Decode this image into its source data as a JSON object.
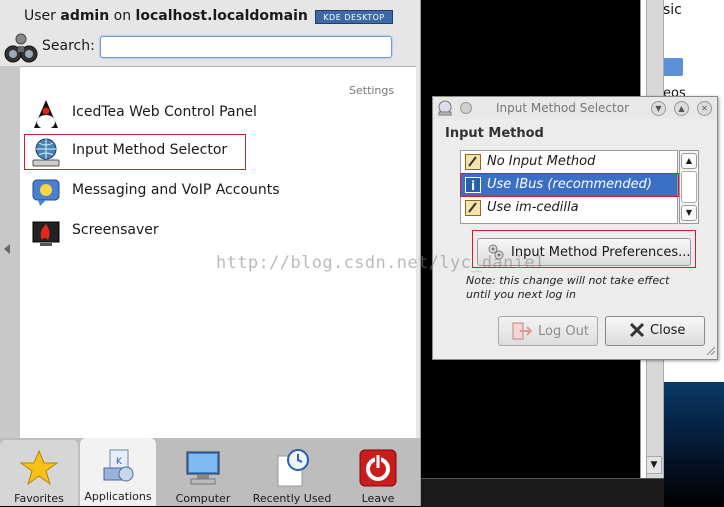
{
  "launcher": {
    "user_prefix": "User ",
    "user_name": "admin",
    "user_mid": " on ",
    "host": "localhost.localdomain",
    "badge": "KDE DESKTOP",
    "search_label": "Search:",
    "search_value": "",
    "search_placeholder": "",
    "section_label": "Settings",
    "items": [
      {
        "label": "IcedTea Web Control Panel",
        "icon": "java-duke-icon"
      },
      {
        "label": "Input Method Selector",
        "icon": "keyboard-globe-icon"
      },
      {
        "label": "Messaging and VoIP Accounts",
        "icon": "chat-bubble-icon"
      },
      {
        "label": "Screensaver",
        "icon": "screensaver-icon"
      }
    ],
    "tabs": [
      {
        "label": "Favorites",
        "icon": "star-icon"
      },
      {
        "label": "Applications",
        "icon": "applications-icon"
      },
      {
        "label": "Computer",
        "icon": "computer-monitor-icon"
      },
      {
        "label": "Recently Used",
        "icon": "clock-icon"
      },
      {
        "label": "Leave",
        "icon": "power-icon"
      }
    ],
    "active_tab": "Applications"
  },
  "dialog": {
    "title": "Input Method Selector",
    "heading": "Input Method",
    "methods": [
      {
        "label": "No Input Method",
        "selected": false
      },
      {
        "label": "Use IBus (recommended)",
        "selected": true
      },
      {
        "label": "Use im-cedilla",
        "selected": false
      }
    ],
    "prefs_label": "Input Method Preferences...",
    "note": "Note: this change will not take effect until you next log in",
    "logout_label": "Log Out",
    "close_label": "Close"
  },
  "background": {
    "text_top": "sic",
    "text_mid": "eos"
  },
  "watermark": "http://blog.csdn.net/lyc_daniel",
  "colors": {
    "highlight_border": "#cc1f2f",
    "selection": "#3b6fc3",
    "kde_badge": "#3d6aa7"
  }
}
